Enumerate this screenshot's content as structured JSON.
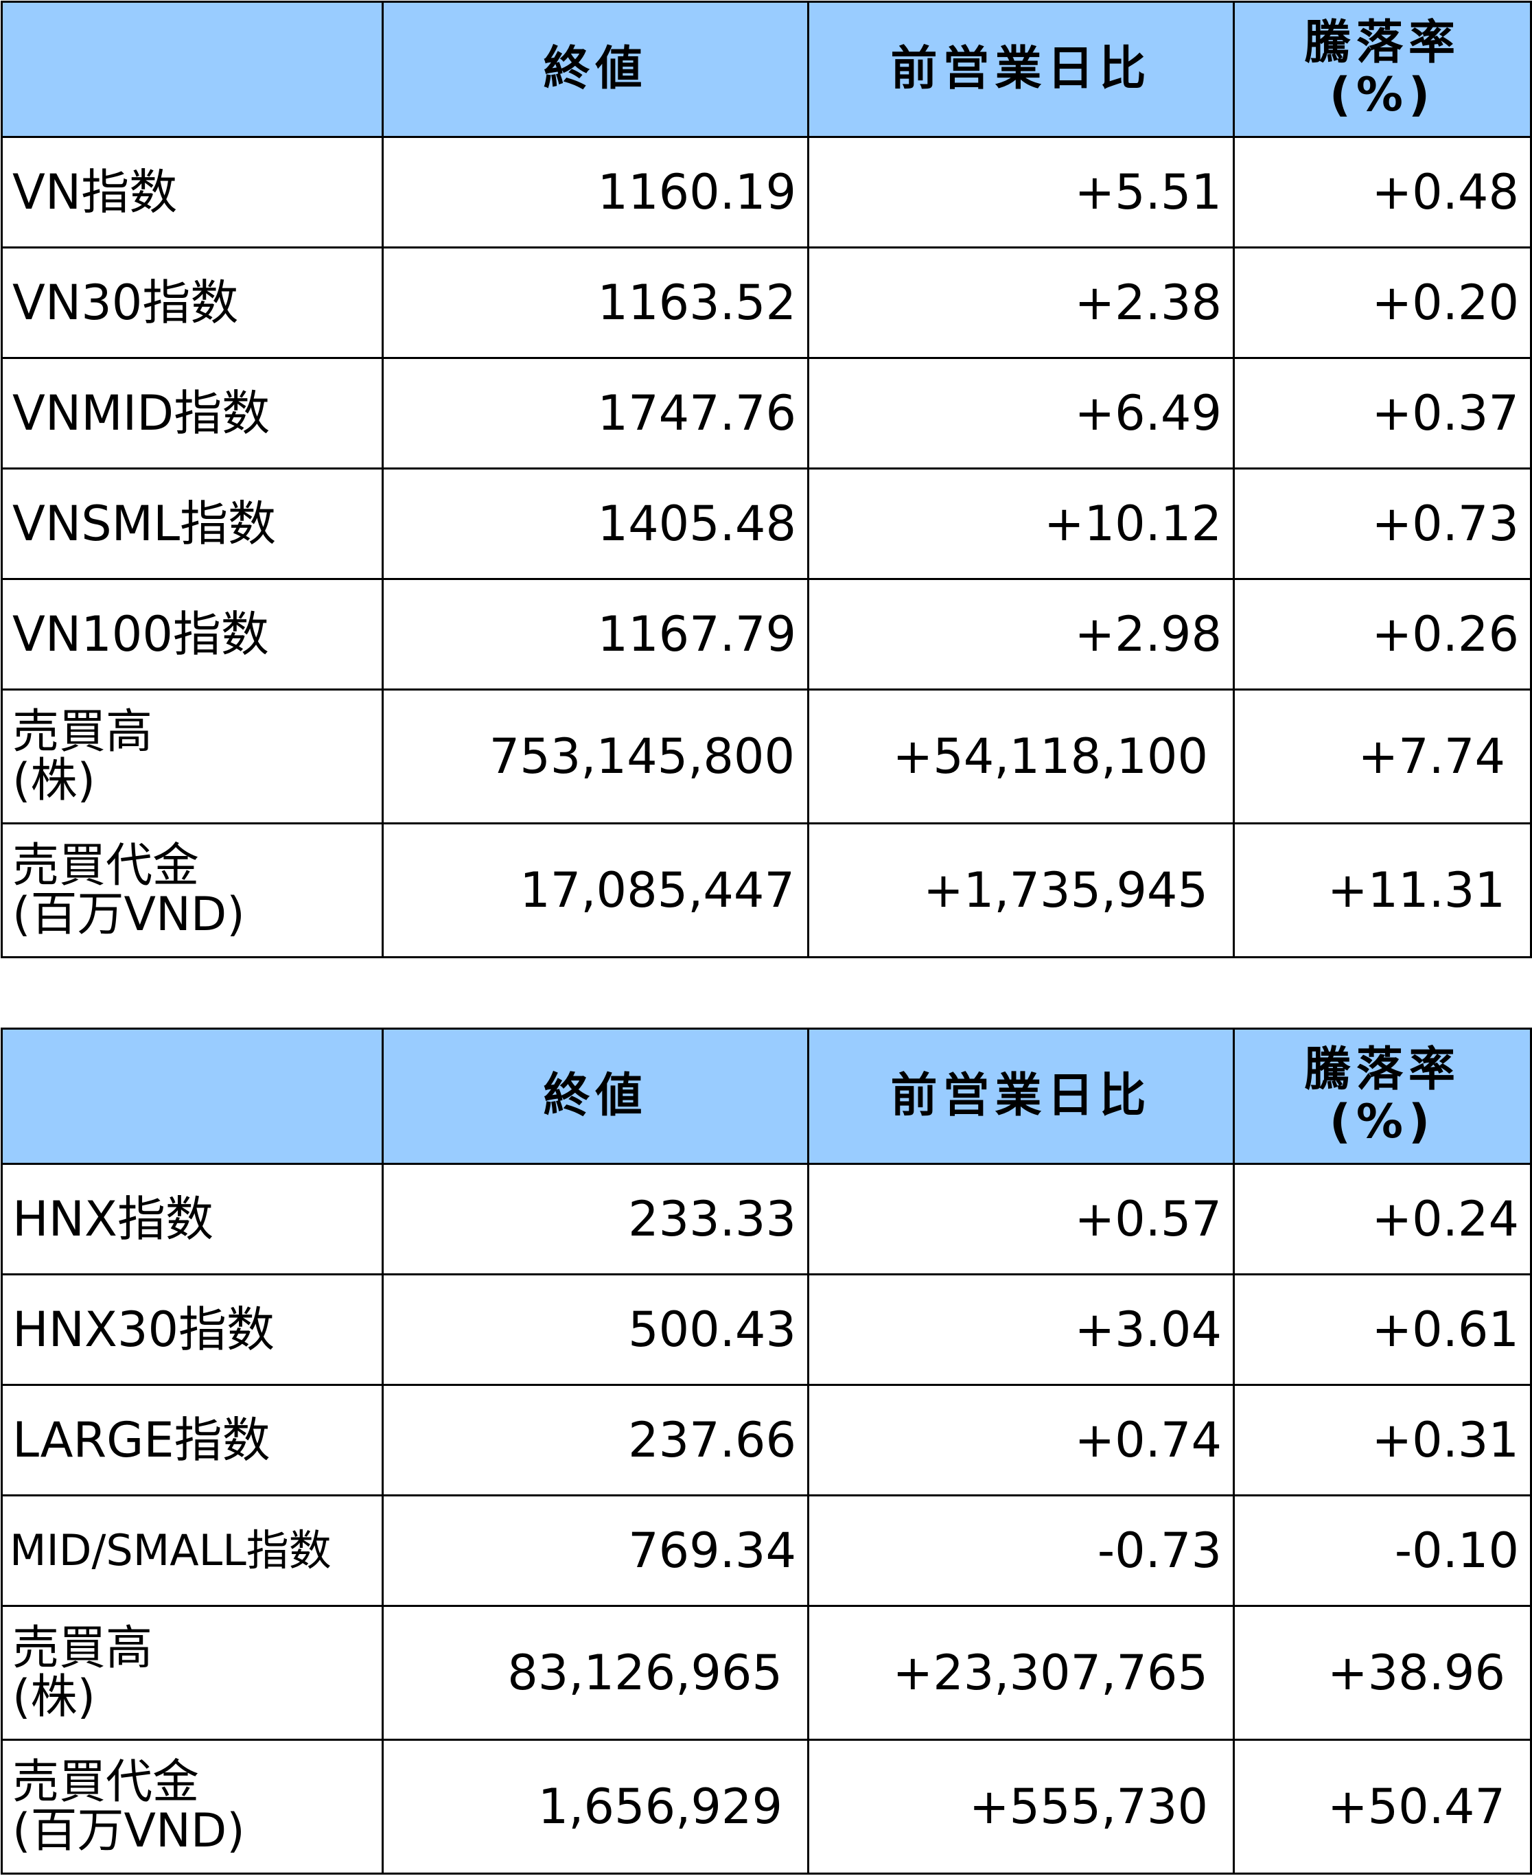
{
  "headers": {
    "close": "終値",
    "change": "前営業日比",
    "rate_line1": "騰落率",
    "rate_line2": "(%)"
  },
  "table_hose": [
    {
      "label": "VN指数",
      "close": "1160.19",
      "change": "+5.51",
      "rate": "+0.48"
    },
    {
      "label": "VN30指数",
      "close": "1163.52",
      "change": "+2.38",
      "rate": "+0.20"
    },
    {
      "label": "VNMID指数",
      "close": "1747.76",
      "change": "+6.49",
      "rate": "+0.37"
    },
    {
      "label": "VNSML指数",
      "close": "1405.48",
      "change": "+10.12",
      "rate": "+0.73"
    },
    {
      "label": "VN100指数",
      "close": "1167.79",
      "change": "+2.98",
      "rate": "+0.26"
    },
    {
      "label": "売買高",
      "label2": "(株)",
      "close": "753,145,800",
      "change": "+54,118,100",
      "rate": "+7.74"
    },
    {
      "label": "売買代金",
      "label2": "(百万VND)",
      "close": "17,085,447",
      "change": "+1,735,945",
      "rate": "+11.31"
    }
  ],
  "table_hnx": [
    {
      "label": "HNX指数",
      "close": "233.33",
      "change": "+0.57",
      "rate": "+0.24"
    },
    {
      "label": "HNX30指数",
      "close": "500.43",
      "change": "+3.04",
      "rate": "+0.61"
    },
    {
      "label": "LARGE指数",
      "close": "237.66",
      "change": "+0.74",
      "rate": "+0.31"
    },
    {
      "label": "MID/SMALL指数",
      "close": "769.34",
      "change": "-0.73",
      "rate": "-0.10"
    },
    {
      "label": "売買高",
      "label2": "(株)",
      "close": "83,126,965",
      "change": "+23,307,765",
      "rate": "+38.96"
    },
    {
      "label": "売買代金",
      "label2": "(百万VND)",
      "close": "1,656,929",
      "change": "+555,730",
      "rate": "+50.47"
    }
  ]
}
